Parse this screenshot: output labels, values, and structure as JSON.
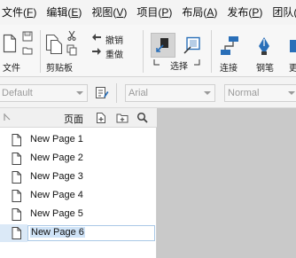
{
  "menubar": {
    "items": [
      {
        "label": "文件(",
        "accel": "F",
        "end": ")"
      },
      {
        "label": "编辑(",
        "accel": "E",
        "end": ")"
      },
      {
        "label": "视图(",
        "accel": "V",
        "end": ")"
      },
      {
        "label": "项目(",
        "accel": "P",
        "end": ")"
      },
      {
        "label": "布局(",
        "accel": "A",
        "end": ")"
      },
      {
        "label": "发布(",
        "accel": "P",
        "end": ")"
      },
      {
        "label": "团队(",
        "accel": "",
        "end": ""
      }
    ]
  },
  "ribbon": {
    "file_label": "文件",
    "clipboard_label": "剪贴板",
    "undo_label": "撤销",
    "redo_label": "重做",
    "select_label": "选择",
    "connect_label": "连接",
    "pen_label": "钢笔",
    "more_label": "更"
  },
  "format": {
    "style_value": "Default",
    "font_value": "Arial",
    "weight_value": "Normal"
  },
  "pages_panel": {
    "title": "页面",
    "pages": [
      {
        "name": "New Page 1"
      },
      {
        "name": "New Page 2"
      },
      {
        "name": "New Page 3"
      },
      {
        "name": "New Page 4"
      },
      {
        "name": "New Page 5"
      },
      {
        "name": "New Page 6"
      }
    ],
    "selected_index": 5
  },
  "colors": {
    "accent_blue": "#2a6fb8",
    "canvas_gray": "#c9c9c9"
  }
}
